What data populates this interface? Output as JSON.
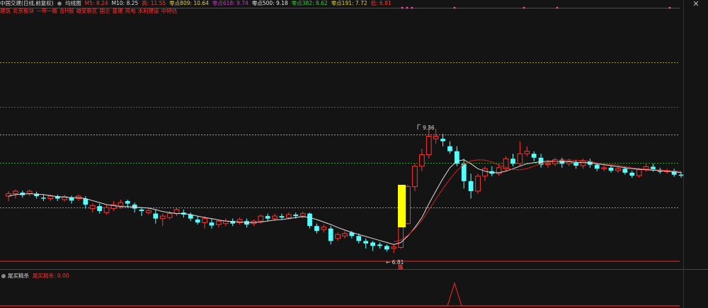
{
  "header": {
    "stock_title": "中国交建(日线,前复权)",
    "indicator_name": "均线图",
    "ma5": "M5: 8.24",
    "ma10": "M10: 8.25",
    "high": "高: 11.55",
    "fib809": "零点809: 10.64",
    "fib618": "零点618: 9.74",
    "fib500": "零点500: 9.18",
    "fib382": "零点382: 8.62",
    "fib191": "零点191: 7.72",
    "low": "低: 6.81"
  },
  "tags": [
    "建筑",
    "北京板块",
    "一带一路",
    "含H股",
    "雄安新区",
    "国企",
    "基建",
    "风电",
    "水利建设",
    "中特估"
  ],
  "annotations": {
    "peak": "9.36",
    "trough": "← 6.81",
    "bottom_marker": "珠"
  },
  "sub_panel": {
    "name": "尾买精杀",
    "value": "尾买精杀: 0.00"
  },
  "colors": {
    "up": "#ff3232",
    "down": "#54ffff",
    "ma": "#dddddd",
    "ma2": "#cc2222",
    "fib809": "#d4c05a",
    "fib618": "#cc33cc",
    "fib500": "#d0d0d0",
    "fib382": "#33cc33",
    "fib191": "#e0d040",
    "highlight": "#ffff00"
  },
  "chart_data": {
    "type": "candlestick",
    "y_range": [
      6.7,
      11.6
    ],
    "fib_levels": [
      10.64,
      9.74,
      9.18,
      8.62,
      7.72
    ],
    "candles": [
      [
        7.95,
        8.0,
        8.05,
        7.85
      ],
      [
        8.0,
        8.05,
        8.08,
        7.9
      ],
      [
        8.02,
        7.97,
        8.06,
        7.92
      ],
      [
        8.0,
        8.05,
        8.08,
        7.95
      ],
      [
        8.0,
        7.95,
        8.04,
        7.9
      ],
      [
        7.92,
        7.9,
        7.98,
        7.85
      ],
      [
        7.9,
        7.95,
        7.98,
        7.85
      ],
      [
        7.95,
        7.9,
        7.98,
        7.85
      ],
      [
        7.88,
        7.94,
        7.98,
        7.84
      ],
      [
        7.92,
        7.86,
        7.96,
        7.8
      ],
      [
        7.9,
        7.95,
        7.98,
        7.85
      ],
      [
        7.9,
        7.78,
        7.95,
        7.7
      ],
      [
        7.7,
        7.76,
        7.8,
        7.62
      ],
      [
        7.75,
        7.65,
        7.8,
        7.6
      ],
      [
        7.62,
        7.72,
        7.78,
        7.58
      ],
      [
        7.7,
        7.78,
        7.85,
        7.65
      ],
      [
        7.75,
        7.82,
        7.88,
        7.7
      ],
      [
        7.85,
        7.8,
        7.88,
        7.72
      ],
      [
        7.78,
        7.7,
        7.82,
        7.62
      ],
      [
        7.68,
        7.65,
        7.72,
        7.55
      ],
      [
        7.62,
        7.66,
        7.7,
        7.58
      ],
      [
        7.6,
        7.5,
        7.68,
        7.4
      ],
      [
        7.5,
        7.55,
        7.6,
        7.35
      ],
      [
        7.52,
        7.6,
        7.65,
        7.48
      ],
      [
        7.6,
        7.68,
        7.72,
        7.55
      ],
      [
        7.62,
        7.58,
        7.68,
        7.52
      ],
      [
        7.58,
        7.5,
        7.62,
        7.45
      ],
      [
        7.48,
        7.42,
        7.55,
        7.38
      ],
      [
        7.42,
        7.5,
        7.55,
        7.3
      ],
      [
        7.42,
        7.36,
        7.5,
        7.3
      ],
      [
        7.38,
        7.45,
        7.48,
        7.32
      ],
      [
        7.4,
        7.45,
        7.5,
        7.35
      ],
      [
        7.45,
        7.4,
        7.5,
        7.35
      ],
      [
        7.42,
        7.48,
        7.52,
        7.38
      ],
      [
        7.45,
        7.38,
        7.5,
        7.32
      ],
      [
        7.4,
        7.45,
        7.48,
        7.35
      ],
      [
        7.45,
        7.55,
        7.58,
        7.4
      ],
      [
        7.55,
        7.5,
        7.6,
        7.45
      ],
      [
        7.5,
        7.55,
        7.6,
        7.45
      ],
      [
        7.55,
        7.52,
        7.6,
        7.48
      ],
      [
        7.52,
        7.58,
        7.62,
        7.48
      ],
      [
        7.58,
        7.55,
        7.62,
        7.5
      ],
      [
        7.55,
        7.6,
        7.64,
        7.5
      ],
      [
        7.6,
        7.35,
        7.62,
        7.3
      ],
      [
        7.35,
        7.25,
        7.4,
        7.2
      ],
      [
        7.28,
        7.33,
        7.38,
        7.22
      ],
      [
        7.3,
        7.05,
        7.35,
        6.98
      ],
      [
        7.1,
        7.18,
        7.22,
        7.05
      ],
      [
        7.15,
        7.2,
        7.25,
        7.1
      ],
      [
        7.22,
        7.15,
        7.25,
        7.1
      ],
      [
        7.15,
        7.05,
        7.2,
        7.0
      ],
      [
        7.05,
        7.0,
        7.1,
        6.9
      ],
      [
        7.02,
        6.95,
        7.05,
        6.85
      ],
      [
        6.98,
        6.95,
        7.02,
        6.9
      ],
      [
        6.95,
        6.88,
        6.98,
        6.84
      ],
      [
        6.9,
        6.93,
        6.98,
        6.81
      ],
      [
        6.92,
        7.4,
        7.45,
        6.9
      ],
      [
        7.4,
        8.14,
        8.18,
        7.38
      ],
      [
        8.14,
        8.55,
        8.6,
        8.05
      ],
      [
        8.55,
        8.78,
        8.9,
        8.45
      ],
      [
        8.78,
        9.15,
        9.36,
        8.7
      ],
      [
        9.1,
        9.15,
        9.3,
        9.0
      ],
      [
        9.1,
        9.05,
        9.2,
        8.95
      ],
      [
        8.95,
        8.85,
        9.05,
        8.8
      ],
      [
        8.85,
        8.6,
        8.95,
        8.55
      ],
      [
        8.6,
        8.25,
        8.7,
        8.1
      ],
      [
        8.25,
        8.05,
        8.4,
        7.9
      ],
      [
        8.05,
        8.35,
        8.4,
        8.0
      ],
      [
        8.35,
        8.5,
        8.55,
        8.25
      ],
      [
        8.45,
        8.4,
        8.55,
        8.35
      ],
      [
        8.4,
        8.52,
        8.6,
        8.35
      ],
      [
        8.5,
        8.7,
        8.75,
        8.45
      ],
      [
        8.7,
        8.6,
        8.8,
        8.55
      ],
      [
        8.6,
        8.8,
        9.05,
        8.55
      ],
      [
        8.8,
        8.85,
        8.95,
        8.75
      ],
      [
        8.8,
        8.72,
        8.85,
        8.65
      ],
      [
        8.72,
        8.58,
        8.8,
        8.52
      ],
      [
        8.58,
        8.6,
        8.68,
        8.52
      ],
      [
        8.6,
        8.68,
        8.72,
        8.55
      ],
      [
        8.68,
        8.6,
        8.72,
        8.52
      ],
      [
        8.6,
        8.65,
        8.7,
        8.55
      ],
      [
        8.62,
        8.56,
        8.68,
        8.5
      ],
      [
        8.56,
        8.65,
        8.7,
        8.5
      ],
      [
        8.65,
        8.58,
        8.7,
        8.52
      ],
      [
        8.58,
        8.5,
        8.62,
        8.45
      ],
      [
        8.5,
        8.52,
        8.58,
        8.45
      ],
      [
        8.52,
        8.46,
        8.56,
        8.42
      ],
      [
        8.46,
        8.5,
        8.55,
        8.42
      ],
      [
        8.5,
        8.42,
        8.54,
        8.38
      ],
      [
        8.42,
        8.36,
        8.46,
        8.32
      ],
      [
        8.36,
        8.48,
        8.52,
        8.32
      ],
      [
        8.48,
        8.54,
        8.6,
        8.44
      ],
      [
        8.54,
        8.48,
        8.6,
        8.44
      ],
      [
        8.48,
        8.44,
        8.52,
        8.4
      ],
      [
        8.44,
        8.46,
        8.5,
        8.4
      ],
      [
        8.46,
        8.38,
        8.5,
        8.34
      ],
      [
        8.38,
        8.36,
        8.44,
        8.32
      ]
    ],
    "ma": [
      7.95,
      7.98,
      7.99,
      8.0,
      7.99,
      7.98,
      7.96,
      7.94,
      7.93,
      7.92,
      7.92,
      7.9,
      7.86,
      7.82,
      7.78,
      7.76,
      7.74,
      7.74,
      7.73,
      7.72,
      7.71,
      7.68,
      7.64,
      7.62,
      7.6,
      7.6,
      7.58,
      7.55,
      7.52,
      7.5,
      7.47,
      7.45,
      7.44,
      7.43,
      7.42,
      7.42,
      7.43,
      7.45,
      7.47,
      7.48,
      7.5,
      7.52,
      7.54,
      7.52,
      7.48,
      7.43,
      7.38,
      7.32,
      7.27,
      7.22,
      7.18,
      7.14,
      7.1,
      7.06,
      7.02,
      6.98,
      7.02,
      7.15,
      7.32,
      7.52,
      7.8,
      8.05,
      8.3,
      8.52,
      8.65,
      8.68,
      8.6,
      8.5,
      8.45,
      8.42,
      8.42,
      8.45,
      8.5,
      8.55,
      8.6,
      8.62,
      8.64,
      8.65,
      8.65,
      8.64,
      8.64,
      8.63,
      8.62,
      8.62,
      8.6,
      8.58,
      8.56,
      8.54,
      8.52,
      8.5,
      8.49,
      8.48,
      8.47,
      8.46,
      8.45,
      8.44,
      8.42
    ]
  }
}
